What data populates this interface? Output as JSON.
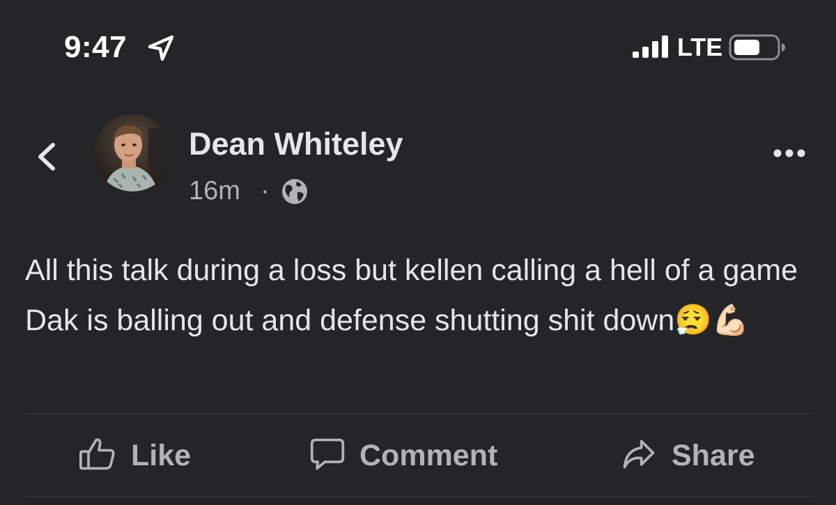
{
  "status_bar": {
    "time": "9:47",
    "network": "LTE",
    "icons": [
      "location-arrow-icon",
      "cellular-signal-icon",
      "battery-icon"
    ]
  },
  "post": {
    "author": "Dean Whiteley",
    "timestamp": "16m",
    "separator": "·",
    "privacy_icon": "globe-icon",
    "text": "All this talk during a loss but kellen calling a hell of a game Dak is balling out and defense shutting shit down😮‍💨💪🏻"
  },
  "actions": {
    "like": "Like",
    "comment": "Comment",
    "share": "Share"
  },
  "colors": {
    "background": "#242526",
    "primary_text": "#e4e6eb",
    "secondary_text": "#b0b3b8",
    "divider": "#3e4042"
  }
}
